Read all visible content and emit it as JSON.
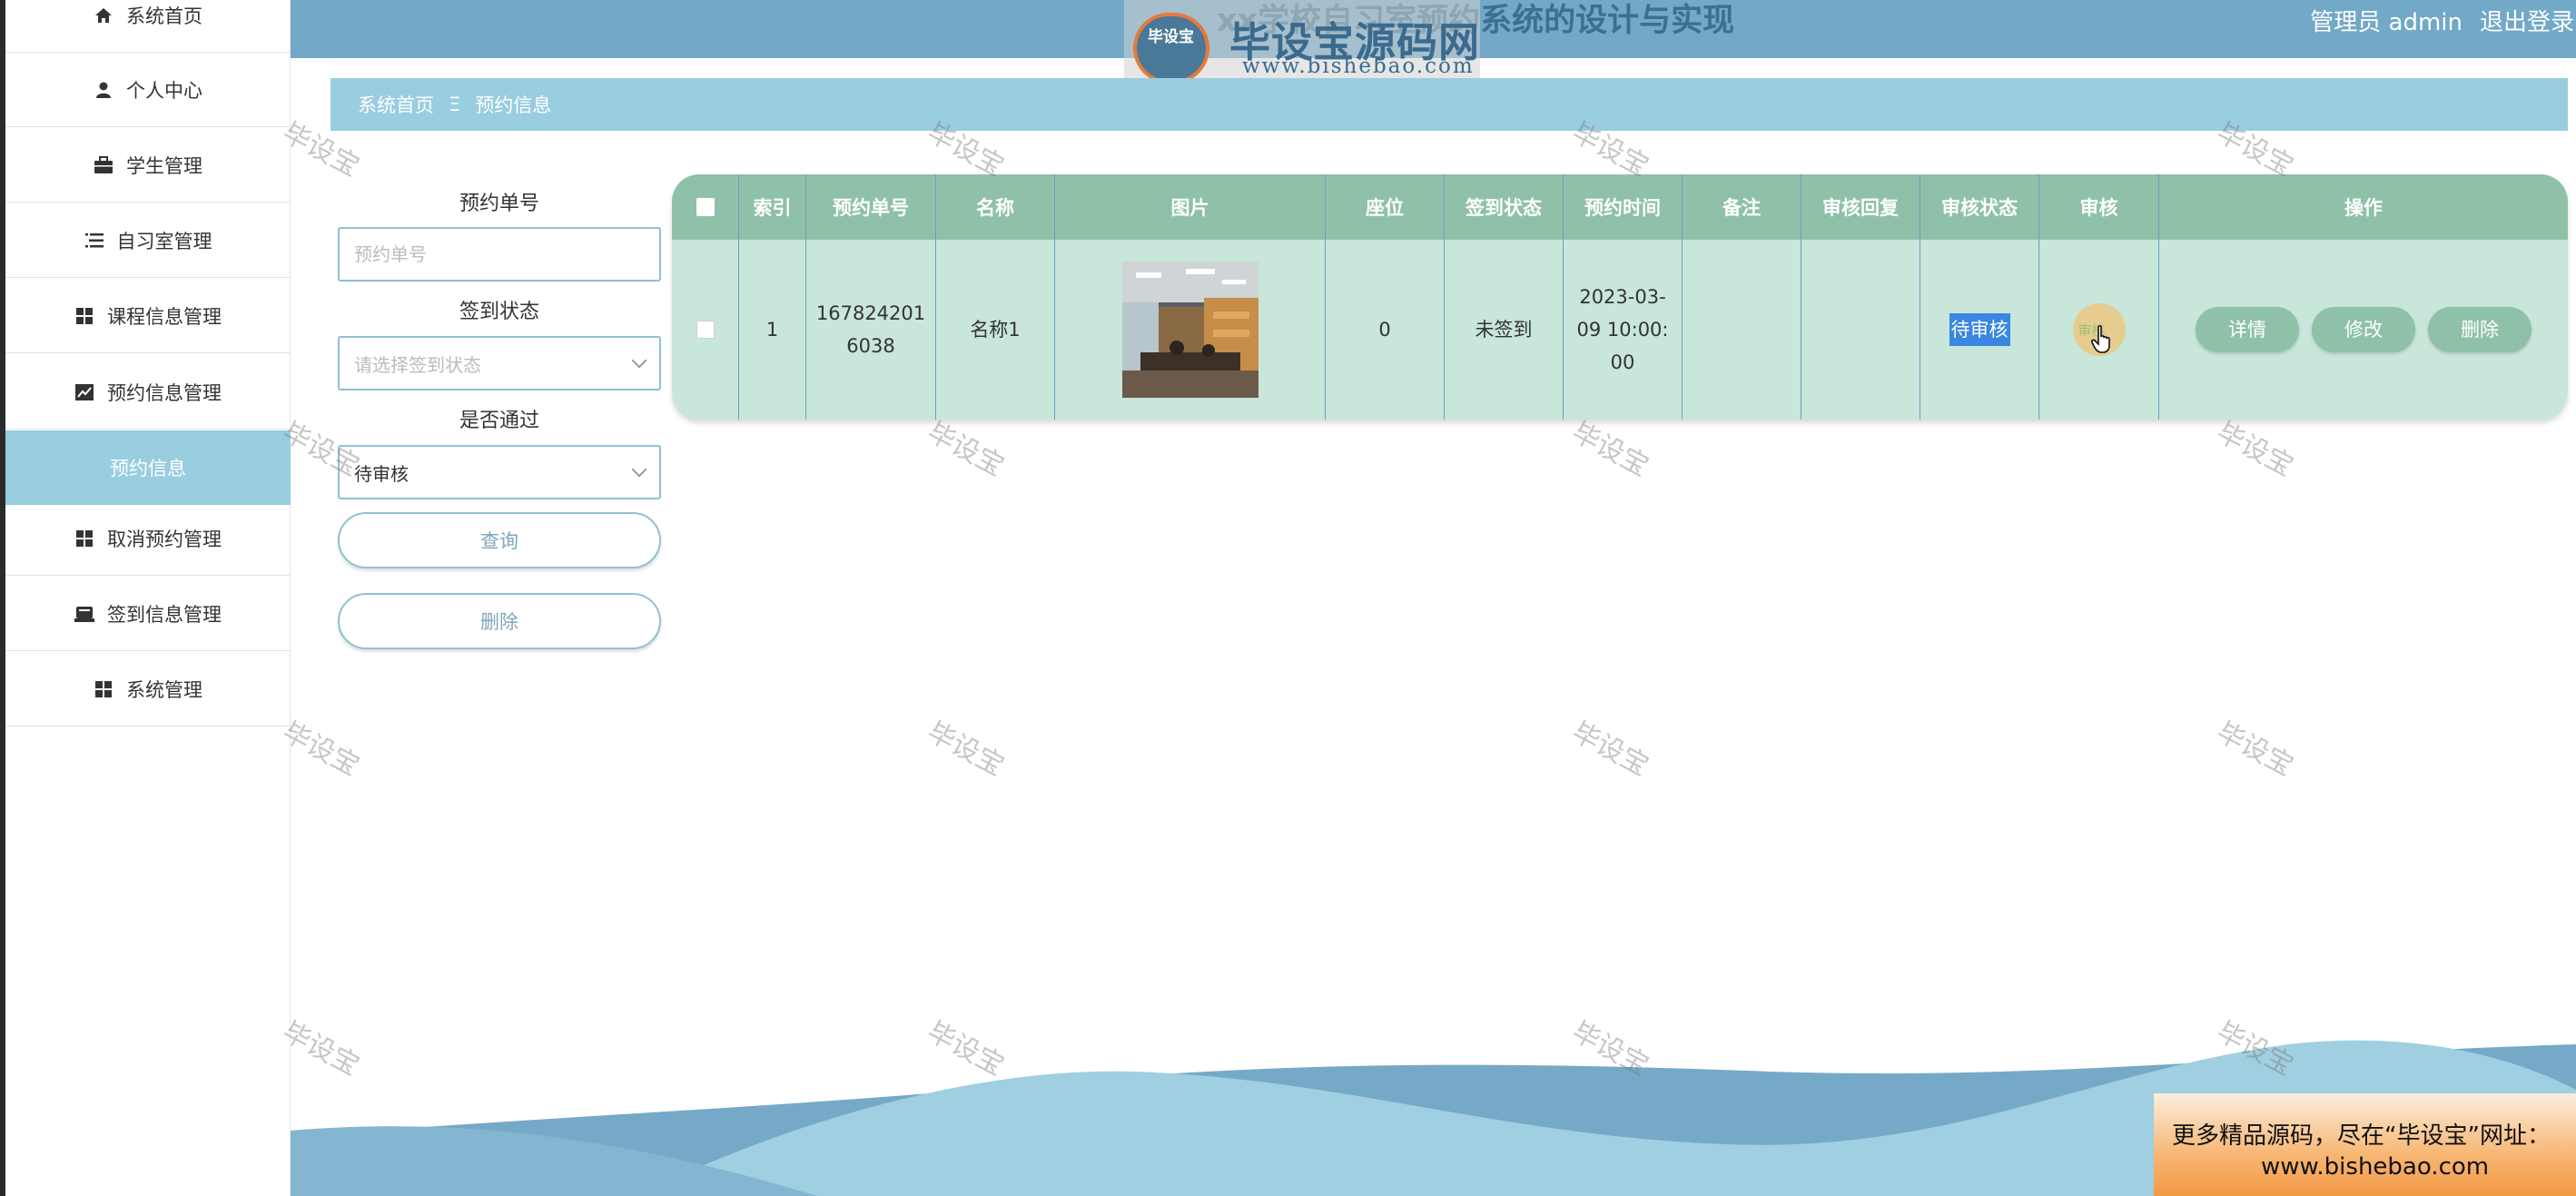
{
  "header": {
    "title": "xx学校自习室预约系统的设计与实现",
    "admin_text": "管理员 admin",
    "logout_label": "退出登录"
  },
  "logo": {
    "badge_text": "毕设宝",
    "name": "毕设宝源码网",
    "url": "www.bishebao.com"
  },
  "sidebar": {
    "items": [
      {
        "label": "系统首页",
        "icon": "home-icon"
      },
      {
        "label": "个人中心",
        "icon": "user-icon"
      },
      {
        "label": "学生管理",
        "icon": "briefcase-icon"
      },
      {
        "label": "自习室管理",
        "icon": "list-icon"
      },
      {
        "label": "课程信息管理",
        "icon": "grid-icon"
      },
      {
        "label": "预约信息管理",
        "icon": "chart-icon"
      },
      {
        "label": "预约信息",
        "icon": ""
      },
      {
        "label": "取消预约管理",
        "icon": "grid-icon"
      },
      {
        "label": "签到信息管理",
        "icon": "printer-icon"
      },
      {
        "label": "系统管理",
        "icon": "grid-icon"
      }
    ],
    "active_index": 6
  },
  "breadcrumb": {
    "home": "系统首页",
    "separator": "Ξ",
    "current": "预约信息"
  },
  "search": {
    "order_no_label": "预约单号",
    "order_no_placeholder": "预约单号",
    "sign_status_label": "签到状态",
    "sign_status_placeholder": "请选择签到状态",
    "pass_label": "是否通过",
    "pass_value": "待审核",
    "query_button": "查询",
    "delete_button": "删除"
  },
  "table": {
    "headers": [
      "索引",
      "预约单号",
      "名称",
      "图片",
      "座位",
      "签到状态",
      "预约时间",
      "备注",
      "审核回复",
      "审核状态",
      "审核",
      "操作"
    ],
    "rows": [
      {
        "index": "1",
        "order_no_line1": "167824201",
        "order_no_line2": "6038",
        "name": "名称1",
        "seat": "0",
        "sign_status": "未签到",
        "time_line1": "2023-03-",
        "time_line2": "09 10:00:",
        "time_line3": "00",
        "remark": "",
        "reply": "",
        "audit_status": "待审核",
        "audit_action": "审核",
        "ops": [
          "详情",
          "修改",
          "删除"
        ]
      }
    ]
  },
  "watermark_text": "毕设宝",
  "ad": {
    "line1": "更多精品源码，尽在“毕设宝”网址：",
    "line2": "www.bishebao.com"
  },
  "colors": {
    "header_bg": "#72a8c8",
    "breadcrumb_bg": "#99cde0",
    "table_header_bg": "#8fc1a9",
    "table_row_bg": "#c8e6da",
    "wave_light": "#9fcfe1",
    "wave_dark": "#6fa4c4"
  }
}
